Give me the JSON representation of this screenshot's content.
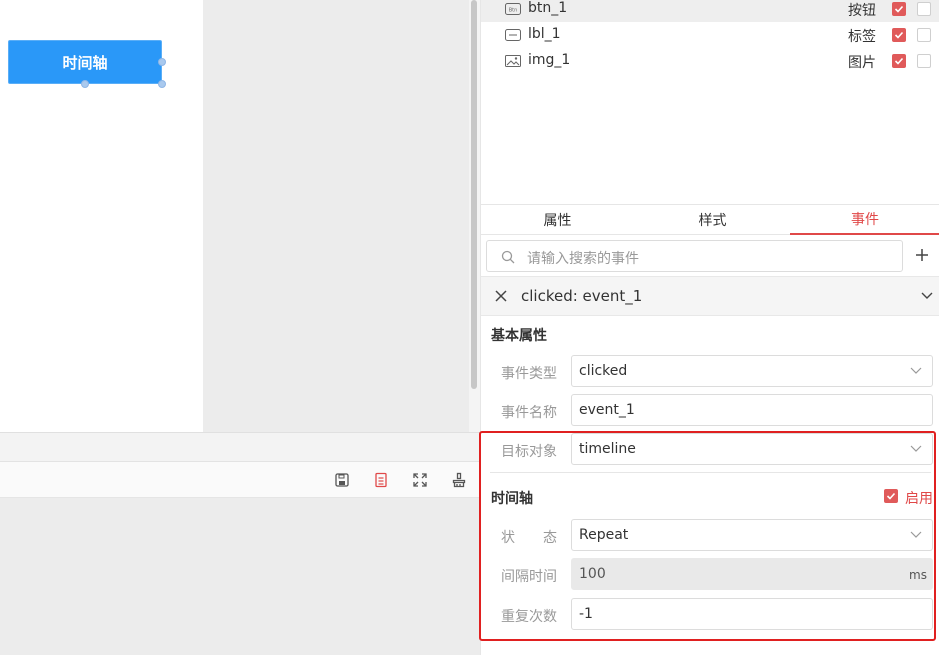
{
  "canvas": {
    "button_label": "时间轴"
  },
  "widgets": [
    {
      "icon": "button-widget-icon",
      "name": "btn_1",
      "type": "按钮",
      "checked": true
    },
    {
      "icon": "label-widget-icon",
      "name": "lbl_1",
      "type": "标签",
      "checked": true
    },
    {
      "icon": "image-widget-icon",
      "name": "img_1",
      "type": "图片",
      "checked": true
    }
  ],
  "tabs": [
    {
      "label": "属性"
    },
    {
      "label": "样式"
    },
    {
      "label": "事件",
      "active": true
    }
  ],
  "search": {
    "placeholder": "请输入搜索的事件"
  },
  "event": {
    "title": "clicked: event_1",
    "basic_section": "基本属性",
    "type_label": "事件类型",
    "type_value": "clicked",
    "name_label": "事件名称",
    "name_value": "event_1",
    "target_label": "目标对象",
    "target_value": "timeline"
  },
  "timeline": {
    "section": "时间轴",
    "enable_label": "启用",
    "enabled": true,
    "state_label": "状　　态",
    "state_value": "Repeat",
    "interval_label": "间隔时间",
    "interval_value": "100",
    "interval_unit": "ms",
    "repeat_label": "重复次数",
    "repeat_value": "-1"
  },
  "colors": {
    "accent": "#e04848",
    "canvas_button": "#2a98f8",
    "highlight": "#e02020"
  }
}
